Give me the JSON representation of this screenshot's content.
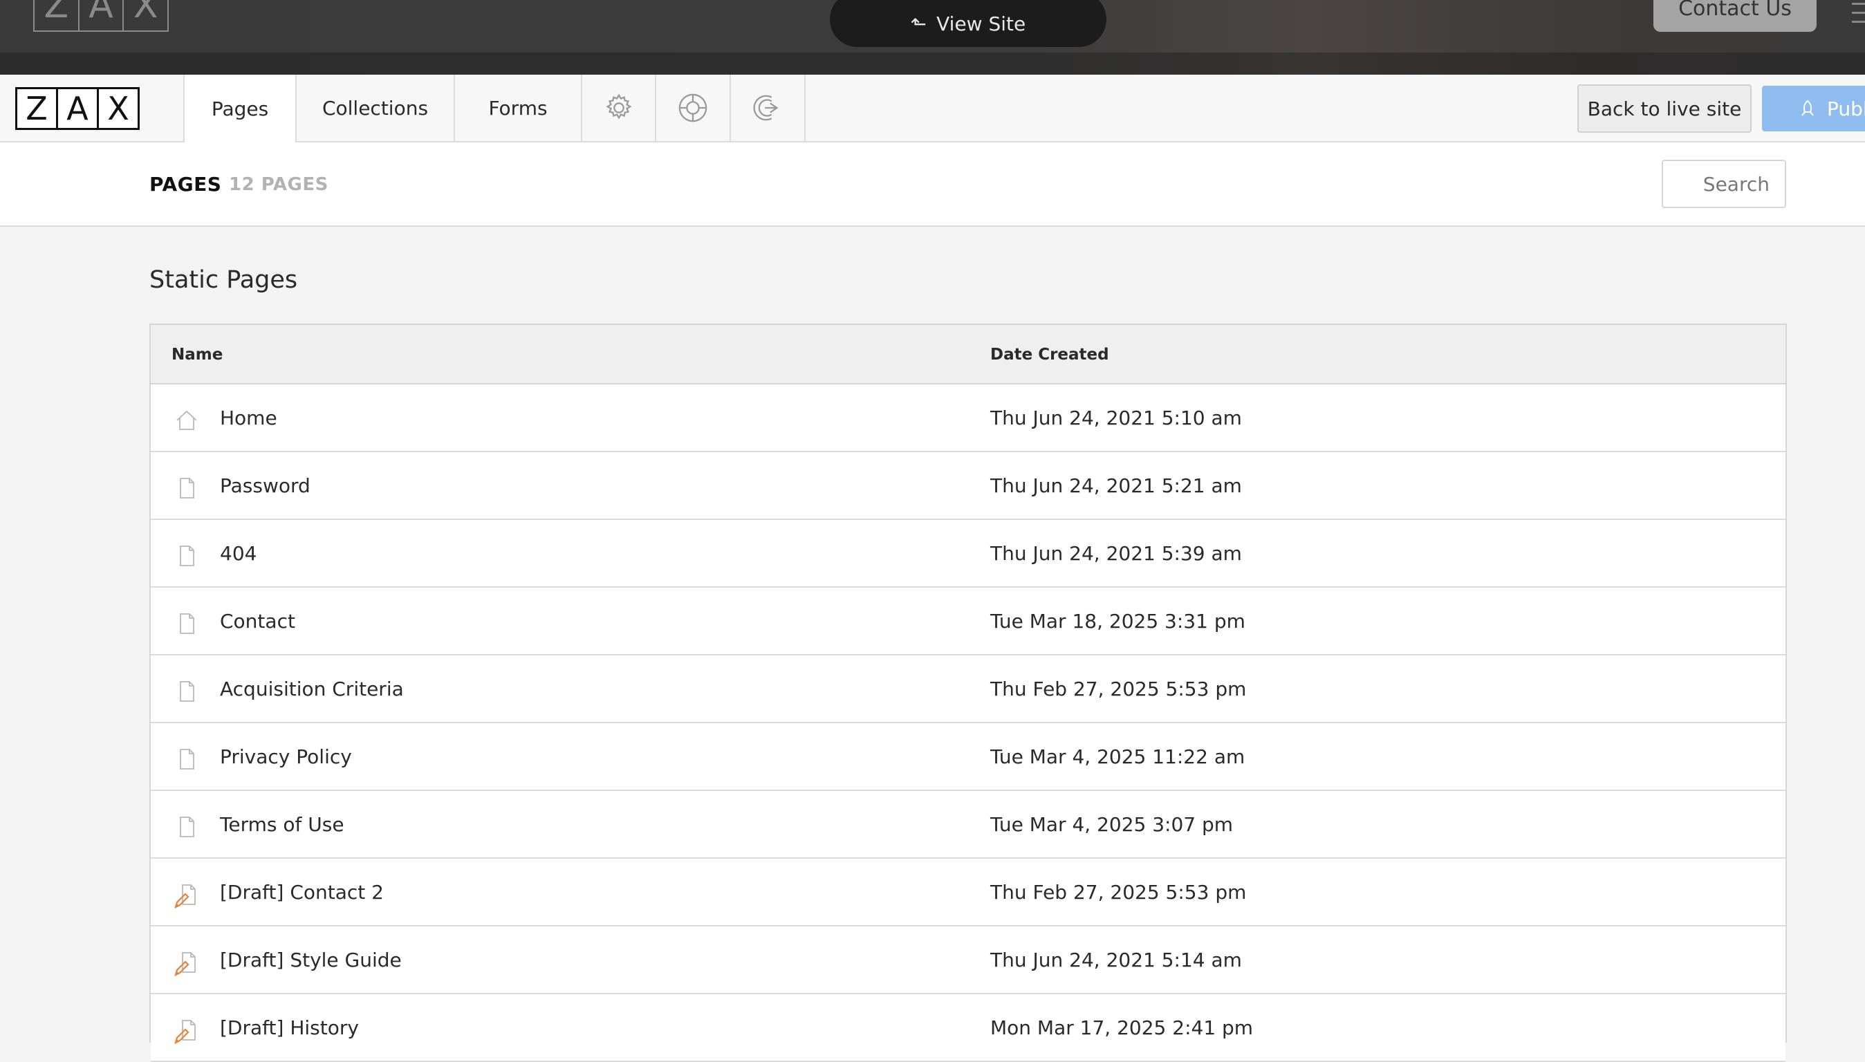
{
  "site_bar": {
    "logo_letters": [
      "Z",
      "A",
      "X"
    ],
    "view_site_label": "View Site",
    "contact_label": "Contact Us"
  },
  "admin_nav": {
    "logo_letters": [
      "Z",
      "A",
      "X"
    ],
    "tabs": [
      {
        "label": "Pages",
        "active": true
      },
      {
        "label": "Collections",
        "active": false
      },
      {
        "label": "Forms",
        "active": false
      }
    ],
    "icon_tabs": [
      "gear-icon",
      "lifebuoy-icon",
      "logout-icon"
    ],
    "back_to_live_label": "Back to live site",
    "publish_label": "Publ",
    "publish_color": "#8fbdf0"
  },
  "sub_header": {
    "title": "PAGES",
    "count": "12 PAGES",
    "search_placeholder": "Search"
  },
  "section": {
    "title": "Static Pages",
    "columns": {
      "name": "Name",
      "date": "Date Created"
    },
    "rows": [
      {
        "icon": "home-icon",
        "name": "Home",
        "date": "Thu Jun 24, 2021 5:10 am"
      },
      {
        "icon": "page-icon",
        "name": "Password",
        "date": "Thu Jun 24, 2021 5:21 am"
      },
      {
        "icon": "page-icon",
        "name": "404",
        "date": "Thu Jun 24, 2021 5:39 am"
      },
      {
        "icon": "page-icon",
        "name": "Contact",
        "date": "Tue Mar 18, 2025 3:31 pm"
      },
      {
        "icon": "page-icon",
        "name": "Acquisition Criteria",
        "date": "Thu Feb 27, 2025 5:53 pm"
      },
      {
        "icon": "page-icon",
        "name": "Privacy Policy",
        "date": "Tue Mar 4, 2025 11:22 am"
      },
      {
        "icon": "page-icon",
        "name": "Terms of Use",
        "date": "Tue Mar 4, 2025 3:07 pm"
      },
      {
        "icon": "draft-page-icon",
        "name": "[Draft] Contact 2",
        "date": "Thu Feb 27, 2025 5:53 pm"
      },
      {
        "icon": "draft-page-icon",
        "name": "[Draft] Style Guide",
        "date": "Thu Jun 24, 2021 5:14 am"
      },
      {
        "icon": "draft-page-icon",
        "name": "[Draft] History",
        "date": "Mon Mar 17, 2025 2:41 pm"
      }
    ]
  },
  "colors": {
    "draft_pencil": "#e8823a",
    "page_icon": "#b8b8b8"
  }
}
